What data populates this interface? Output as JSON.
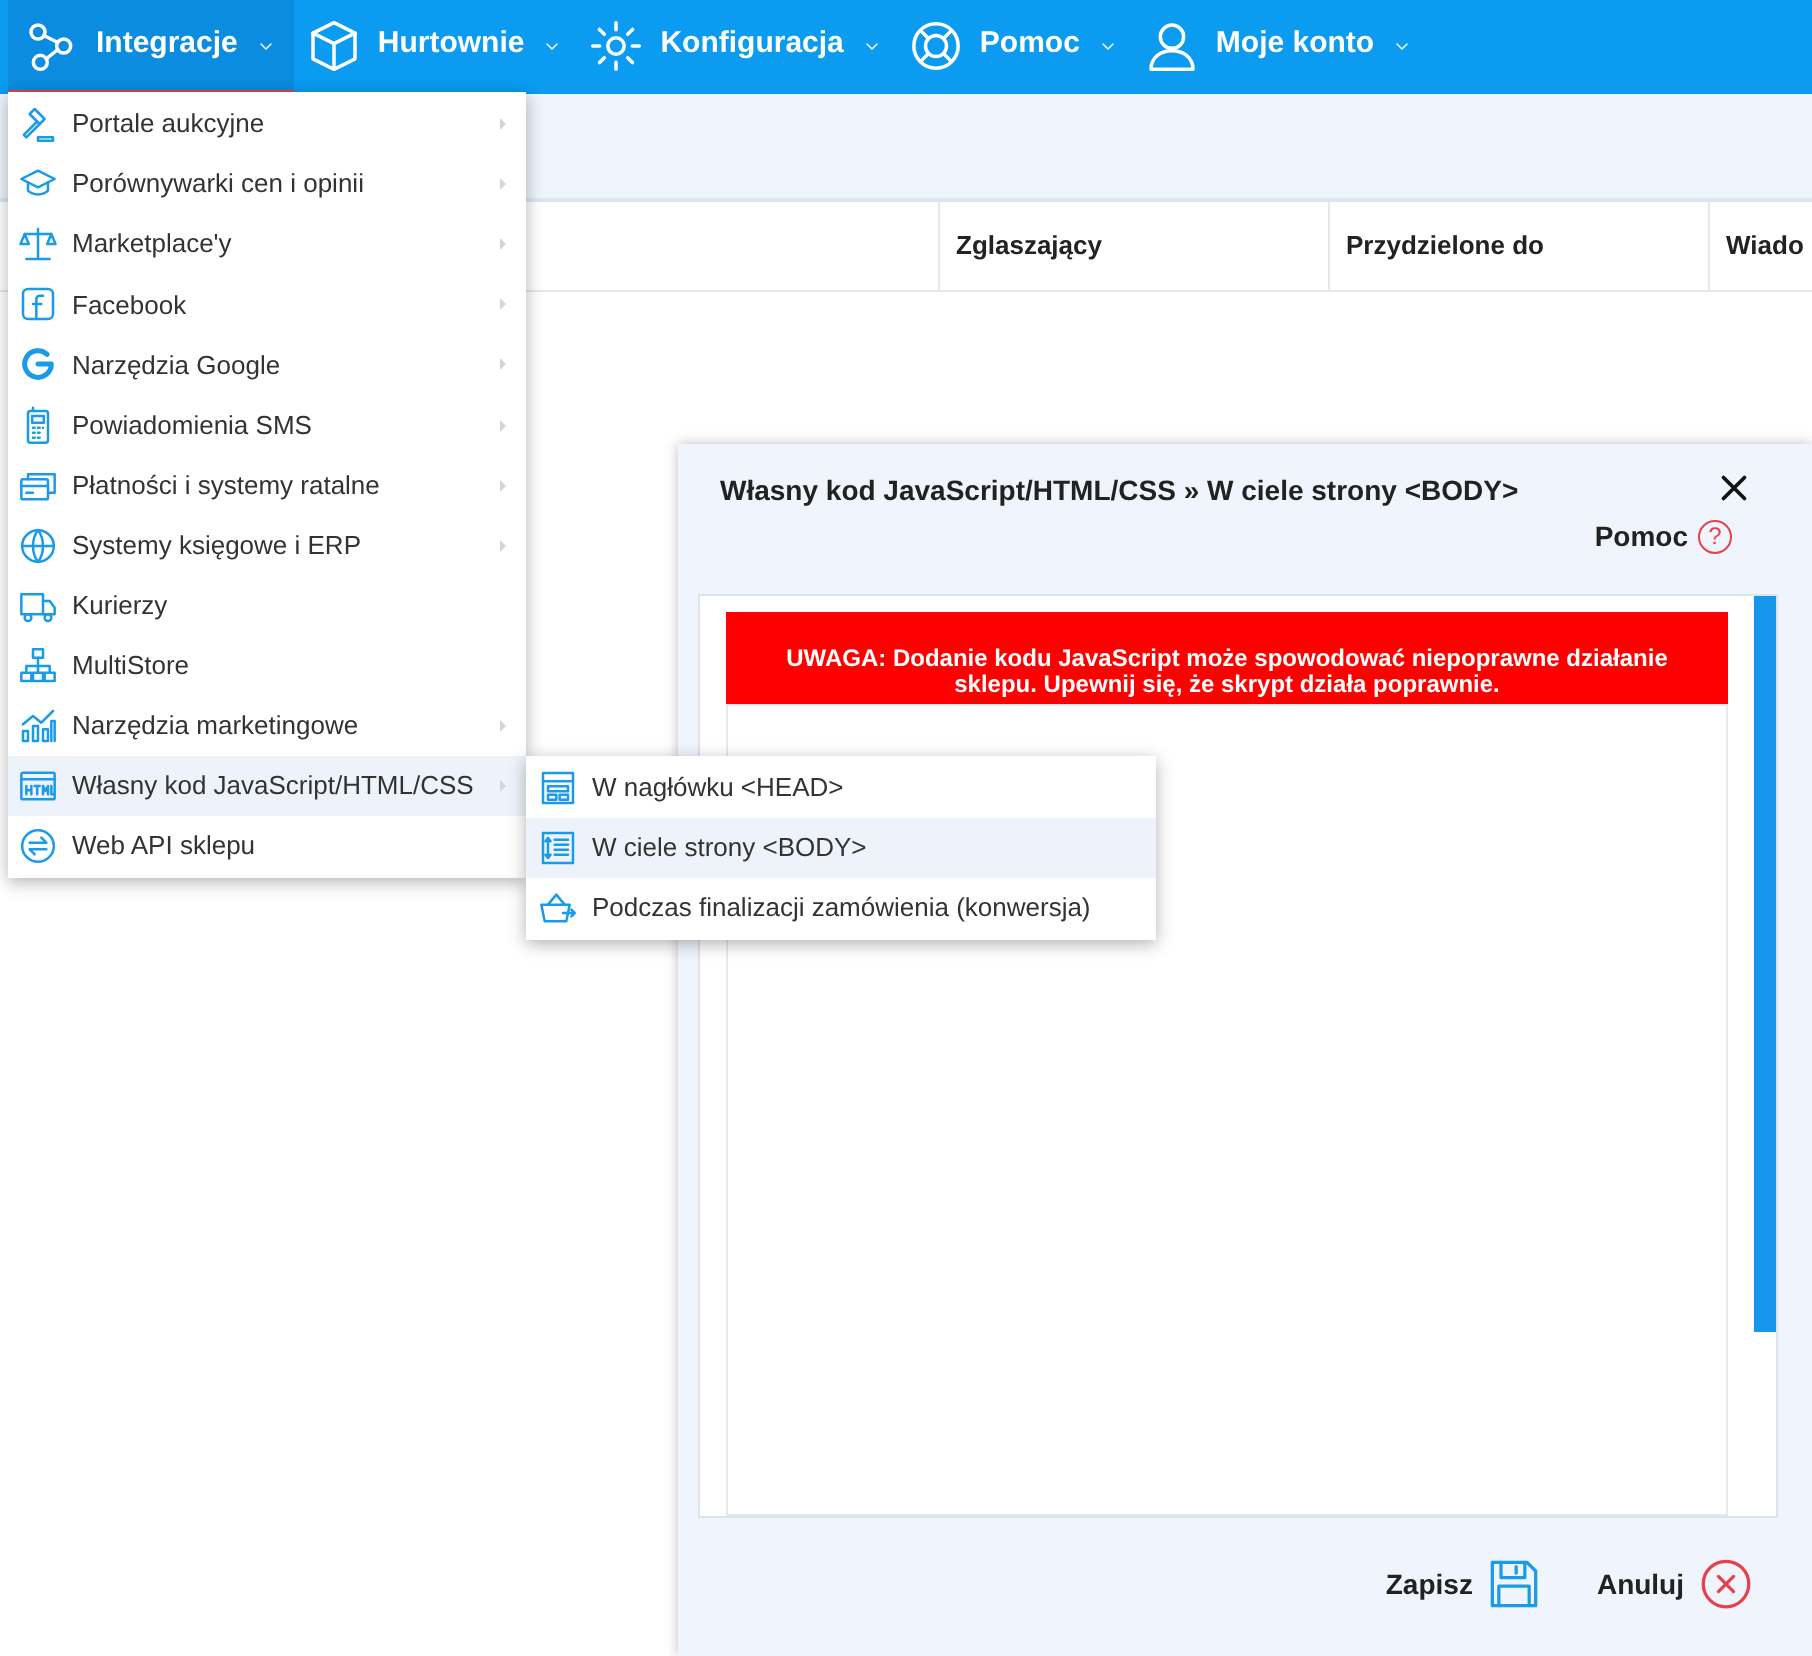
{
  "nav": [
    {
      "label": "Integracje",
      "selected": true
    },
    {
      "label": "Hurtownie",
      "selected": false
    },
    {
      "label": "Konfiguracja",
      "selected": false
    },
    {
      "label": "Pomoc",
      "selected": false
    },
    {
      "label": "Moje konto",
      "selected": false
    }
  ],
  "table": {
    "columns": [
      "Zglaszający",
      "Przydzielone do",
      "Wiado"
    ]
  },
  "menu": [
    {
      "label": "Portale aukcyjne",
      "has_submenu": true,
      "selected": false
    },
    {
      "label": "Porównywarki cen i opinii",
      "has_submenu": true,
      "selected": false
    },
    {
      "label": "Marketplace'y",
      "has_submenu": true,
      "selected": false
    },
    {
      "label": "Facebook",
      "has_submenu": true,
      "selected": false
    },
    {
      "label": "Narzędzia Google",
      "has_submenu": true,
      "selected": false
    },
    {
      "label": "Powiadomienia SMS",
      "has_submenu": true,
      "selected": false
    },
    {
      "label": "Płatności i systemy ratalne",
      "has_submenu": true,
      "selected": false
    },
    {
      "label": "Systemy księgowe i ERP",
      "has_submenu": true,
      "selected": false
    },
    {
      "label": "Kurierzy",
      "has_submenu": false,
      "selected": false
    },
    {
      "label": "MultiStore",
      "has_submenu": false,
      "selected": false
    },
    {
      "label": "Narzędzia marketingowe",
      "has_submenu": true,
      "selected": false
    },
    {
      "label": "Własny kod JavaScript/HTML/CSS",
      "has_submenu": true,
      "selected": true
    },
    {
      "label": "Web API sklepu",
      "has_submenu": false,
      "selected": false
    }
  ],
  "submenu": [
    {
      "label": "W nagłówku <HEAD>",
      "selected": false
    },
    {
      "label": "W ciele strony <BODY>",
      "selected": true
    },
    {
      "label": "Podczas finalizacji zamówienia (konwersja)",
      "selected": false
    }
  ],
  "modal": {
    "title": "Własny kod JavaScript/HTML/CSS » W ciele strony <BODY>",
    "help_label": "Pomoc",
    "help_icon": "?",
    "warning": "UWAGA: Dodanie kodu JavaScript może spowodować niepoprawne działanie sklepu. Upewnij się, że skrypt działa poprawnie.",
    "buttons": [
      {
        "label": "Zapisz",
        "kind": "save"
      },
      {
        "label": "Anuluj",
        "kind": "cancel"
      }
    ]
  }
}
